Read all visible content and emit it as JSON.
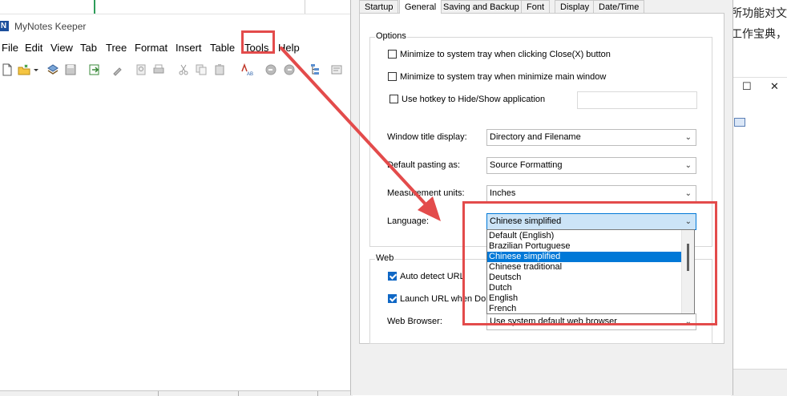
{
  "app": {
    "title": "MyNotes Keeper",
    "logo_letter": "N",
    "menu": [
      "File",
      "Edit",
      "View",
      "Tab",
      "Tree",
      "Format",
      "Insert",
      "Table",
      "Tools",
      "Help"
    ]
  },
  "right_window": {
    "text_line1": "所功能对文",
    "text_line2": "工作宝典，",
    "restore_symbol": "☐",
    "close_symbol": "✕"
  },
  "dialog": {
    "tabs": [
      "Startup",
      "General",
      "Saving and Backup",
      "Font",
      "Display",
      "Date/Time"
    ],
    "active_tab": "General",
    "options_group": {
      "label": "Options",
      "checkboxes": [
        {
          "label": "Minimize to system tray when clicking Close(X) button",
          "checked": false
        },
        {
          "label": "Minimize to system tray when minimize main window",
          "checked": false
        },
        {
          "label": "Use hotkey to Hide/Show application",
          "checked": false
        }
      ],
      "hotkey_value": "",
      "fields": [
        {
          "label": "Window title display:",
          "value": "Directory and Filename"
        },
        {
          "label": "Default pasting as:",
          "value": "Source Formatting"
        },
        {
          "label": "Measurement units:",
          "value": "Inches"
        },
        {
          "label": "Language:",
          "value": "Chinese simplified"
        }
      ]
    },
    "language_options": [
      "Default (English)",
      "Brazilian Portuguese",
      "Chinese simplified",
      "Chinese traditional",
      "Deutsch",
      "Dutch",
      "English",
      "French"
    ],
    "selected_language": "Chinese simplified",
    "web_group": {
      "label": "Web",
      "checkboxes": [
        {
          "label": "Auto detect URL",
          "checked": true
        },
        {
          "label": "Launch URL when Double click",
          "checked": true
        }
      ],
      "browser_label": "Web Browser:",
      "browser_value": "Use system default web browser"
    }
  },
  "annotation": {
    "color": "#e34b4b"
  },
  "icons": [
    "new-note-icon",
    "open-folder-icon",
    "dropdown-icon",
    "database-icon",
    "save-icon",
    "export-icon",
    "broom-icon",
    "search-doc-icon",
    "print-icon",
    "cut-icon",
    "copy-icon",
    "paste-icon",
    "spellcheck-icon",
    "undo-icon",
    "redo-icon",
    "tree-icon",
    "options-icon"
  ]
}
